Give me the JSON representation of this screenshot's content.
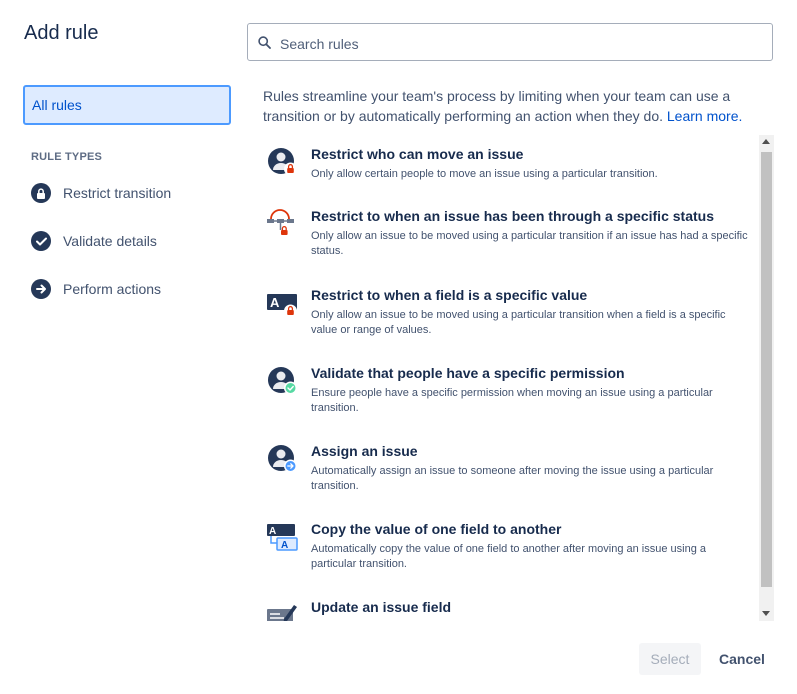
{
  "dialog": {
    "title": "Add rule"
  },
  "search": {
    "placeholder": "Search rules",
    "value": ""
  },
  "sidebar": {
    "all_rules_label": "All rules",
    "rule_types_heading": "RULE TYPES",
    "items": [
      {
        "label": "Restrict transition",
        "icon": "lock-icon"
      },
      {
        "label": "Validate details",
        "icon": "check-icon"
      },
      {
        "label": "Perform actions",
        "icon": "arrow-right-icon"
      }
    ]
  },
  "main": {
    "description": "Rules streamline your team's process by limiting when your team can use a transition or by automatically performing an action when they do.",
    "learn_more": "Learn more.",
    "rules": [
      {
        "title": "Restrict who can move an issue",
        "description": "Only allow certain people to move an issue using a particular transition.",
        "icon": "user-lock-icon"
      },
      {
        "title": "Restrict to when an issue has been through a specific status",
        "description": "Only allow an issue to be moved using a particular transition if an issue has had a specific status.",
        "icon": "workflow-lock-icon"
      },
      {
        "title": "Restrict to when a field is a specific value",
        "description": "Only allow an issue to be moved using a particular transition when a field is a specific value or range of values.",
        "icon": "field-lock-icon"
      },
      {
        "title": "Validate that people have a specific permission",
        "description": "Ensure people have a specific permission when moving an issue using a particular transition.",
        "icon": "user-check-icon"
      },
      {
        "title": "Assign an issue",
        "description": "Automatically assign an issue to someone after moving the issue using a particular transition.",
        "icon": "user-arrow-icon"
      },
      {
        "title": "Copy the value of one field to another",
        "description": "Automatically copy the value of one field to another after moving an issue using a particular transition.",
        "icon": "copy-field-icon"
      },
      {
        "title": "Update an issue field",
        "description": "",
        "icon": "edit-field-icon"
      }
    ]
  },
  "footer": {
    "select_label": "Select",
    "cancel_label": "Cancel"
  },
  "colors": {
    "accent": "#0052cc",
    "selected_bg": "#deebff",
    "selected_border": "#4c9aff",
    "dark": "#253858",
    "lock_red": "#de350b",
    "check_green": "#57d9a3",
    "arrow_blue": "#4c9aff"
  }
}
